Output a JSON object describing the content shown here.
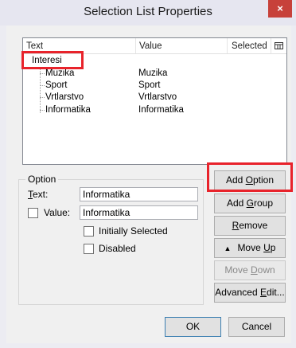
{
  "window": {
    "title": "Selection List Properties",
    "close_glyph": "×"
  },
  "list": {
    "columns": [
      "Text",
      "Value",
      "Selected"
    ],
    "group_label": "Interesi",
    "items": [
      {
        "text": "Muzika",
        "value": "Muzika"
      },
      {
        "text": "Sport",
        "value": "Sport"
      },
      {
        "text": "Vrtlarstvo",
        "value": "Vrtlarstvo"
      },
      {
        "text": "Informatika",
        "value": "Informatika"
      }
    ]
  },
  "option": {
    "legend": "Option",
    "text_label_pre": "",
    "text_label_u": "T",
    "text_label_post": "ext:",
    "text_value": "Informatika",
    "value_label": "Value:",
    "value_value": "Informatika",
    "initially_selected_label": "Initially Selected",
    "disabled_label": "Disabled"
  },
  "buttons": {
    "add_option_pre": "Add ",
    "add_option_u": "O",
    "add_option_post": "ption",
    "add_group_pre": "Add ",
    "add_group_u": "G",
    "add_group_post": "roup",
    "remove_u": "R",
    "remove_post": "emove",
    "move_up_pre": "Move ",
    "move_up_u": "U",
    "move_up_post": "p",
    "move_down_pre": "Move ",
    "move_down_u": "D",
    "move_down_post": "own",
    "advanced_pre": "Advanced ",
    "advanced_u": "E",
    "advanced_post": "dit...",
    "ok": "OK",
    "cancel": "Cancel"
  },
  "colors": {
    "highlight": "#e8232b",
    "close": "#c7413a"
  }
}
